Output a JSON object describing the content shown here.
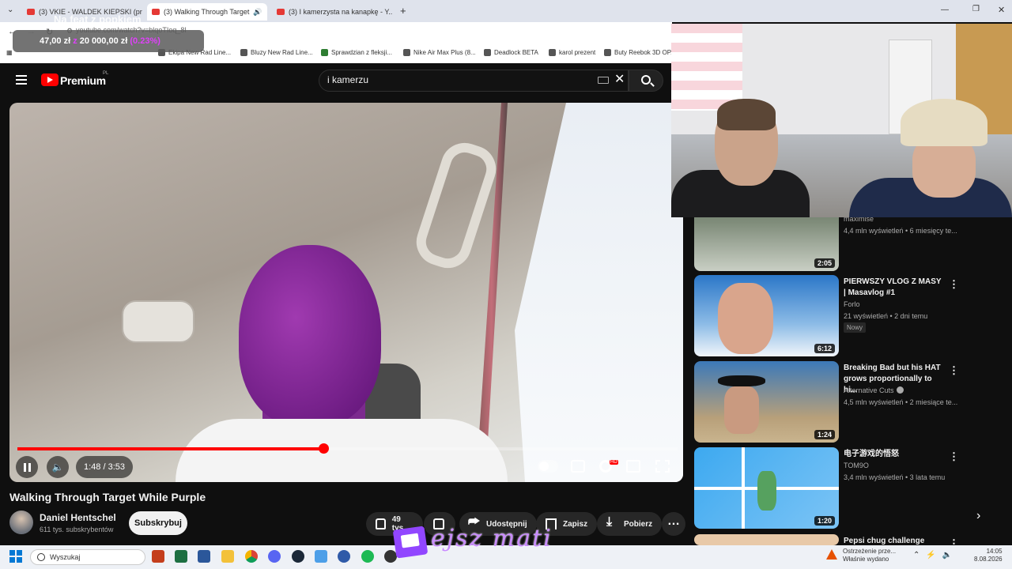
{
  "browser": {
    "tabs": [
      {
        "title": "(3) VKIE - WALDEK KIEPSKI (pro..."
      },
      {
        "title": "(3) Walking Through Target"
      },
      {
        "title": "(3) I kamerzysta na kanapkę - Y..."
      }
    ],
    "url": "youtube.com/watch?v=blqoTIoq_8I",
    "bookmarks": [
      "Bluzy New Rad Line...",
      "Sprawdzian z fleksji...",
      "Nike Air Max Plus (8...",
      "Deadlock BETA",
      "karol prezent",
      "Buty Reebok 3D OP..."
    ],
    "bookmark_left": "Ekipa New Rad Line..."
  },
  "donation": {
    "title": "Na feat z popkiem",
    "amount": "47,00 zł",
    "separator": "z",
    "goal": "20 000,00 zł",
    "percent": "(0.23%)"
  },
  "youtube": {
    "brand": "Premium",
    "brand_region": "PL",
    "search_value": "i kamerzu"
  },
  "player": {
    "time": "1:48 / 3:53",
    "progress": 0.463,
    "hd": "HD"
  },
  "video": {
    "title": "Walking Through Target While Purple",
    "channel": "Daniel Hentschel",
    "subscribers": "611 tys. subskrybentów",
    "subscribe_label": "Subskrybuj",
    "likes": "49 tys.",
    "share_label": "Udostępnij",
    "save_label": "Zapisz",
    "download_label": "Pobierz",
    "more_label": "…"
  },
  "sidebar": {
    "partial": {
      "channel": "maximise",
      "meta": "4,4 mln wyświetleń • 6 miesięcy te..."
    },
    "items": [
      {
        "title": "",
        "channel": "",
        "meta": "",
        "duration": "2:05"
      },
      {
        "title": "PIERWSZY VLOG Z MASY | Masavlog #1",
        "channel": "Forlo",
        "meta": "21 wyświetleń • 2 dni temu",
        "badge": "Nowy",
        "duration": "6:12"
      },
      {
        "title": "Breaking Bad but his HAT grows proportionally to hi...",
        "channel": "Alternative Cuts",
        "meta": "4,5 mln wyświetleń • 2 miesiące te...",
        "duration": "1:24"
      },
      {
        "title": "电子游戏的悟怒",
        "channel": "TOM9O",
        "meta": "3,4 mln wyświetleń • 3 lata temu",
        "duration": "1:20"
      },
      {
        "title": "Pepsi chug challenge",
        "channel": "",
        "meta": "",
        "duration": ""
      }
    ]
  },
  "taskbar": {
    "search_placeholder": "Wyszukaj",
    "notice_line1": "Ostrzeżenie prze...",
    "notice_line2": "Właśnie wydano",
    "time": "14:05",
    "date": "8.08.2026"
  },
  "overlay": {
    "handle": "ejsz mati"
  },
  "colors": {
    "yt_red": "#ff0000",
    "twitch": "#9146ff",
    "bg": "#0f0f0f"
  }
}
